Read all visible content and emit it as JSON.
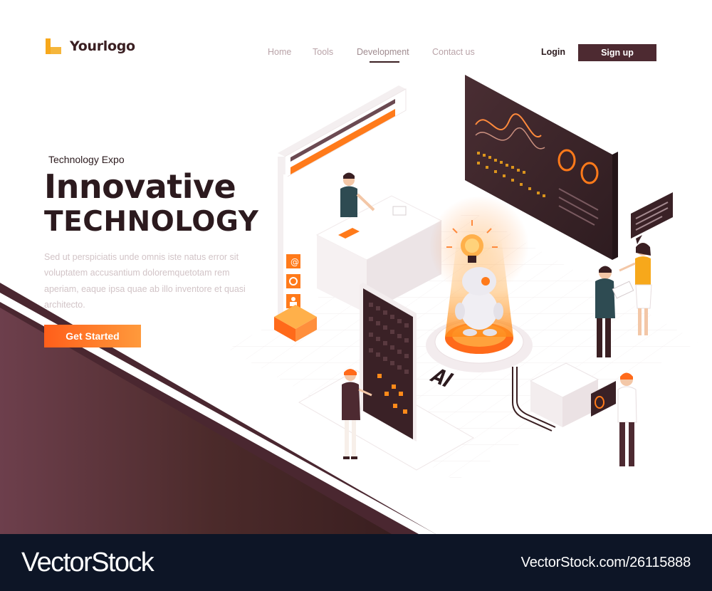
{
  "brand": {
    "logo_text": "Yourlogo",
    "accent": "#f7a81b"
  },
  "nav": {
    "items": [
      "Home",
      "Tools",
      "Development",
      "Contact us"
    ],
    "active": "Development"
  },
  "auth": {
    "login_label": "Login",
    "signup_label": "Sign up"
  },
  "hero": {
    "eyebrow": "Technology Expo",
    "title_line1": "Innovative",
    "title_line2": "TECHNOLOGY",
    "body": "Sed ut perspiciatis unde omnis iste natus error sit voluptatem accusantium doloremquetotam rem aperiam, eaque ipsa quae ab illo inventore et quasi architecto.",
    "cta_label": "Get Started"
  },
  "illustration": {
    "ai_label": "AI",
    "booth_icons": [
      "@",
      "gear",
      "person"
    ]
  },
  "colors": {
    "primary_dark": "#4d2a31",
    "text_dark": "#2c1a1e",
    "orange": "#ff6a1a",
    "footer_bg": "#0d1526"
  },
  "watermark": {
    "brand": "VectorStock",
    "id": "VectorStock.com/26115888"
  }
}
